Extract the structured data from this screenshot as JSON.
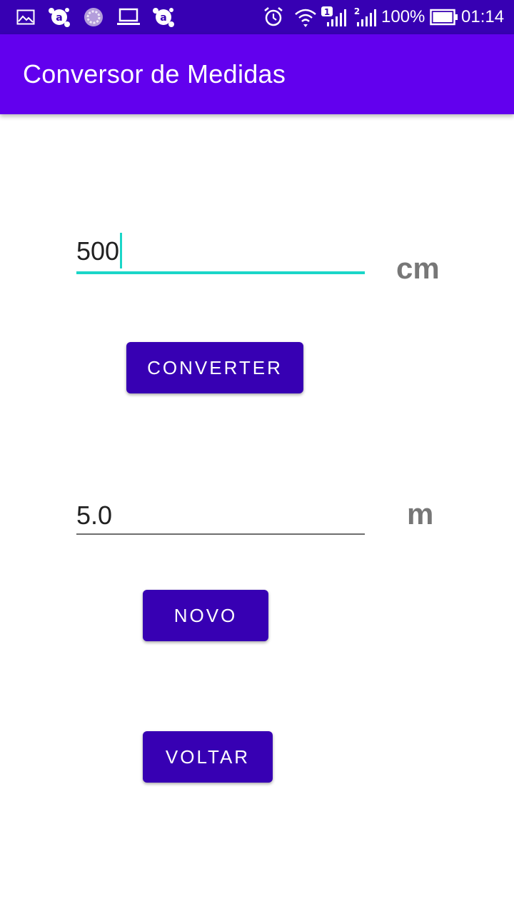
{
  "status_bar": {
    "icons_left": [
      "image-icon",
      "avast-icon",
      "loading-icon",
      "laptop-icon",
      "avast-icon"
    ],
    "battery_percent": "100%",
    "time": "01:14",
    "sim1_label": "1",
    "sim2_label": "2",
    "battery_level": 1.0
  },
  "app_bar": {
    "title": "Conversor de Medidas",
    "color": "#6200ee"
  },
  "input": {
    "value": "500",
    "unit": "cm"
  },
  "result": {
    "value": "5.0",
    "unit": "m"
  },
  "buttons": {
    "convert": "CONVERTER",
    "new": "NOVO",
    "back": "VOLTAR"
  },
  "colors": {
    "status_bar": "#3700b3",
    "primary": "#6200ee",
    "button": "#3700b3",
    "accent": "#1bd6c8",
    "unit_text": "#777777"
  }
}
